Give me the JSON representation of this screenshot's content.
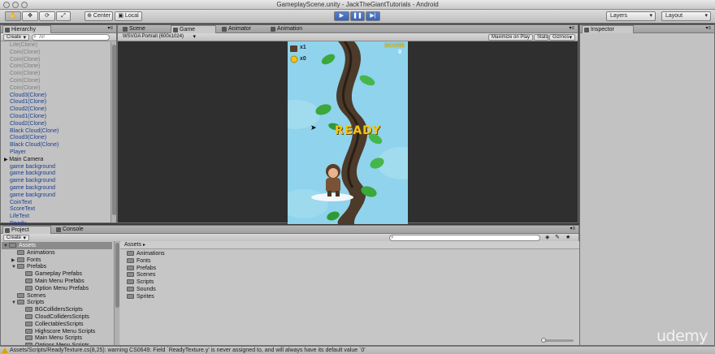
{
  "window": {
    "title": "GameplayScene.unity - JackTheGiantTutorials - Android"
  },
  "toolbar": {
    "center_label": "Center",
    "local_label": "Local",
    "layers_label": "Layers",
    "layout_label": "Layout"
  },
  "hierarchy": {
    "tab_label": "Hierarchy",
    "create_label": "Create",
    "search_placeholder": "All",
    "items": [
      {
        "label": "Life(Clone)",
        "style": "grey"
      },
      {
        "label": "Coin(Clone)",
        "style": "grey"
      },
      {
        "label": "Coin(Clone)",
        "style": "grey"
      },
      {
        "label": "Coin(Clone)",
        "style": "grey"
      },
      {
        "label": "Coin(Clone)",
        "style": "grey"
      },
      {
        "label": "Coin(Clone)",
        "style": "grey"
      },
      {
        "label": "Coin(Clone)",
        "style": "grey"
      },
      {
        "label": "Cloud3(Clone)",
        "style": "blue"
      },
      {
        "label": "Cloud1(Clone)",
        "style": "blue"
      },
      {
        "label": "Cloud2(Clone)",
        "style": "blue"
      },
      {
        "label": "Cloud1(Clone)",
        "style": "blue"
      },
      {
        "label": "Cloud2(Clone)",
        "style": "blue"
      },
      {
        "label": "Black Cloud(Clone)",
        "style": "blue"
      },
      {
        "label": "Cloud3(Clone)",
        "style": "blue"
      },
      {
        "label": "Black Cloud(Clone)",
        "style": "blue"
      },
      {
        "label": "Player",
        "style": "blue"
      },
      {
        "label": "Main Camera",
        "style": "expand"
      },
      {
        "label": "game background",
        "style": "blue"
      },
      {
        "label": "game background",
        "style": "blue"
      },
      {
        "label": "game background",
        "style": "blue"
      },
      {
        "label": "game background",
        "style": "blue"
      },
      {
        "label": "game background",
        "style": "blue"
      },
      {
        "label": "CoinText",
        "style": "blue"
      },
      {
        "label": "ScoreText",
        "style": "blue"
      },
      {
        "label": "LifeText",
        "style": "blue"
      },
      {
        "label": "Ready",
        "style": "blue"
      }
    ]
  },
  "center_tabs": [
    {
      "label": "Scene"
    },
    {
      "label": "Game"
    },
    {
      "label": "Animator"
    },
    {
      "label": "Animation"
    }
  ],
  "game_view": {
    "resolution_label": "WSVGA Portrait (600x1024)",
    "maximize_label": "Maximize on Play",
    "stats_label": "Stats",
    "gizmos_label": "Gizmos",
    "hud": {
      "life_count": "x1",
      "coin_count": "x0",
      "score_label": "SCORE",
      "score_value": "0"
    },
    "ready_text": "READY"
  },
  "inspector": {
    "tab_label": "Inspector"
  },
  "project": {
    "tab_label": "Project",
    "console_tab_label": "Console",
    "create_label": "Create",
    "tree": [
      {
        "label": "Assets",
        "indent": 0,
        "arrow": "▼",
        "selected": true
      },
      {
        "label": "Animations",
        "indent": 1,
        "arrow": ""
      },
      {
        "label": "Fonts",
        "indent": 1,
        "arrow": "▶"
      },
      {
        "label": "Prefabs",
        "indent": 1,
        "arrow": "▼"
      },
      {
        "label": "Gameplay Prefabs",
        "indent": 2,
        "arrow": ""
      },
      {
        "label": "Main Menu Prefabs",
        "indent": 2,
        "arrow": ""
      },
      {
        "label": "Option Menu Prefabs",
        "indent": 2,
        "arrow": ""
      },
      {
        "label": "Scenes",
        "indent": 1,
        "arrow": ""
      },
      {
        "label": "Scripts",
        "indent": 1,
        "arrow": "▼"
      },
      {
        "label": "BGCollidersScripts",
        "indent": 2,
        "arrow": ""
      },
      {
        "label": "CloudCollidersScripts",
        "indent": 2,
        "arrow": ""
      },
      {
        "label": "CollectablesScripts",
        "indent": 2,
        "arrow": ""
      },
      {
        "label": "Highscore Menu Scripts",
        "indent": 2,
        "arrow": ""
      },
      {
        "label": "Main Menu Scripts",
        "indent": 2,
        "arrow": ""
      },
      {
        "label": "Options Menu Scripts",
        "indent": 2,
        "arrow": ""
      }
    ],
    "breadcrumb": "Assets",
    "assets": [
      "Animations",
      "Fonts",
      "Prefabs",
      "Scenes",
      "Scripts",
      "Sounds",
      "Sprites"
    ]
  },
  "status": {
    "message": "Assets/Scripts/ReadyTexture.cs(8,25): warning CS0649: Field `ReadyTexture.y' is never assigned to, and will always have its default value `0'"
  },
  "watermark": "udemy"
}
